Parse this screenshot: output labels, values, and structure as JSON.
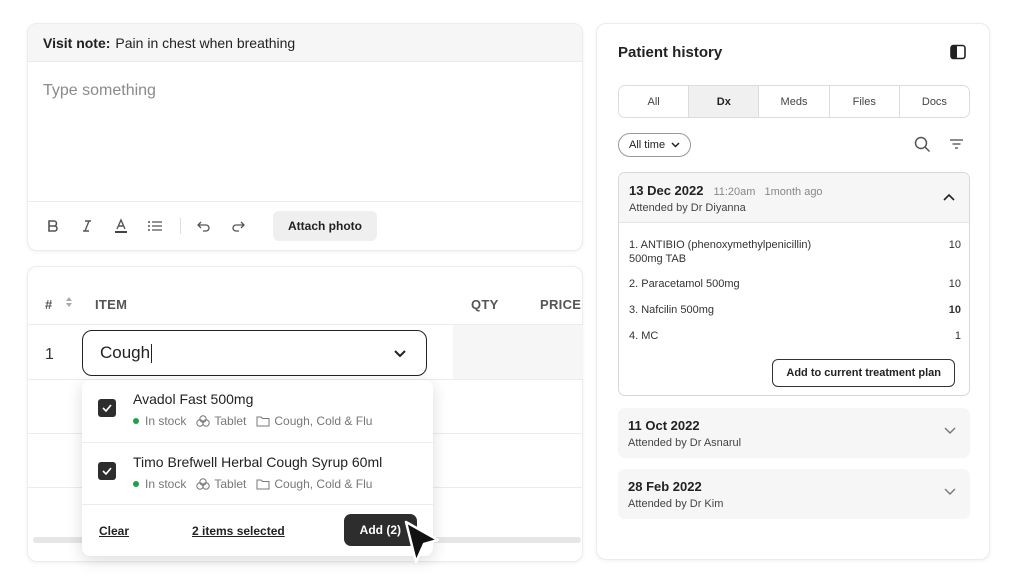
{
  "visit_note": {
    "label": "Visit note:",
    "value": "Pain in chest when breathing",
    "placeholder": "Type something",
    "toolbar": {
      "bold_icon": "bold-icon",
      "italic_icon": "italic-icon",
      "text_color_icon": "text-color-icon",
      "list_icon": "bullet-list-icon",
      "undo_icon": "undo-icon",
      "redo_icon": "redo-icon",
      "attach_label": "Attach photo"
    }
  },
  "items_table": {
    "headers": {
      "num": "#",
      "item": "ITEM",
      "qty": "QTY",
      "price": "PRICE"
    },
    "rows": [
      {
        "num": "1"
      }
    ],
    "search": {
      "value": "Cough"
    },
    "dropdown": {
      "options": [
        {
          "name": "Avadol Fast 500mg",
          "stock": "In stock",
          "form": "Tablet",
          "category": "Cough, Cold & Flu",
          "checked": true
        },
        {
          "name": "Timo Brefwell Herbal Cough Syrup 60ml",
          "stock": "In stock",
          "form": "Tablet",
          "category": "Cough, Cold & Flu",
          "checked": true
        }
      ],
      "clear_label": "Clear",
      "selected_label": "2 items selected",
      "add_label": "Add (2)"
    }
  },
  "patient_history": {
    "title": "Patient history",
    "tabs": [
      {
        "label": "All",
        "active": false
      },
      {
        "label": "Dx",
        "active": true
      },
      {
        "label": "Meds",
        "active": false
      },
      {
        "label": "Files",
        "active": false
      },
      {
        "label": "Docs",
        "active": false
      }
    ],
    "time_filter": "All time",
    "visits": [
      {
        "date": "13 Dec 2022",
        "time": "11:20am",
        "ago": "1month ago",
        "attended": "Attended by Dr Diyanna",
        "expanded": true,
        "meds": [
          {
            "name": "1. ANTIBIO (phenoxymethylpenicillin) 500mg TAB",
            "qty": "10"
          },
          {
            "name": "2. Paracetamol 500mg",
            "qty": "10"
          },
          {
            "name": "3. Nafcilin 500mg",
            "qty": "10"
          },
          {
            "name": "4. MC",
            "qty": "1"
          }
        ],
        "action_label": "Add to current treatment plan"
      },
      {
        "date": "11 Oct 2022",
        "attended": "Attended by Dr Asnarul",
        "expanded": false
      },
      {
        "date": "28 Feb 2022",
        "attended": "Attended by Dr Kim",
        "expanded": false
      }
    ]
  },
  "colors": {
    "accent": "#2d2d2d",
    "in_stock": "#22a04b",
    "panel_bg": "#f6f6f6"
  }
}
